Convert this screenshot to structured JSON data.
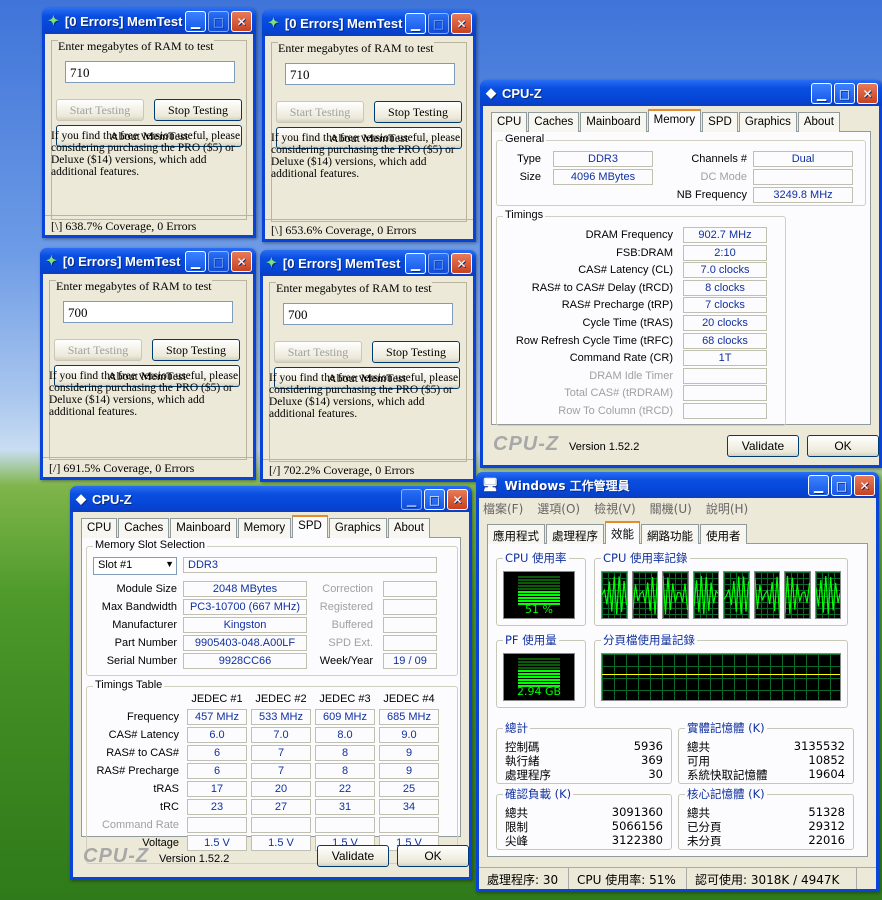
{
  "memtest": [
    {
      "title": "[0 Errors] MemTest",
      "prompt": "Enter megabytes of RAM to test",
      "value": "710",
      "start": "Start Testing",
      "stop": "Stop Testing",
      "about": "About MemTest",
      "info": "If you find the free version useful, please considering purchasing the PRO ($5) or Deluxe ($14) versions, which add additional features.",
      "status": "[\\]   638.7% Coverage, 0 Errors"
    },
    {
      "title": "[0 Errors] MemTest",
      "prompt": "Enter megabytes of RAM to test",
      "value": "710",
      "start": "Start Testing",
      "stop": "Stop Testing",
      "about": "About MemTest",
      "info": "If you find the free version useful, please considering purchasing the PRO ($5) or Deluxe ($14) versions, which add additional features.",
      "status": "[\\]   653.6% Coverage, 0 Errors"
    },
    {
      "title": "[0 Errors] MemTest",
      "prompt": "Enter megabytes of RAM to test",
      "value": "700",
      "start": "Start Testing",
      "stop": "Stop Testing",
      "about": "About MemTest",
      "info": "If you find the free version useful, please considering purchasing the PRO ($5) or Deluxe ($14) versions, which add additional features.",
      "status": "[/]   691.5% Coverage, 0 Errors"
    },
    {
      "title": "[0 Errors] MemTest",
      "prompt": "Enter megabytes of RAM to test",
      "value": "700",
      "start": "Start Testing",
      "stop": "Stop Testing",
      "about": "About MemTest",
      "info": "If you find the free version useful, please considering purchasing the PRO ($5) or Deluxe ($14) versions, which add additional features.",
      "status": "[/]   702.2% Coverage, 0 Errors"
    }
  ],
  "cpuz_mem": {
    "title": "CPU-Z",
    "tabs": [
      "CPU",
      "Caches",
      "Mainboard",
      "Memory",
      "SPD",
      "Graphics",
      "About"
    ],
    "active_tab": "Memory",
    "general_label": "General",
    "type_label": "Type",
    "type": "DDR3",
    "size_label": "Size",
    "size": "4096 MBytes",
    "channels_label": "Channels #",
    "channels": "Dual",
    "dcmode_label": "DC Mode",
    "dcmode": "",
    "nbfreq_label": "NB Frequency",
    "nbfreq": "3249.8 MHz",
    "timings_label": "Timings",
    "timings": [
      {
        "label": "DRAM Frequency",
        "value": "902.7 MHz",
        "dim": false
      },
      {
        "label": "FSB:DRAM",
        "value": "2:10",
        "dim": false
      },
      {
        "label": "CAS# Latency (CL)",
        "value": "7.0 clocks",
        "dim": false
      },
      {
        "label": "RAS# to CAS# Delay (tRCD)",
        "value": "8 clocks",
        "dim": false
      },
      {
        "label": "RAS# Precharge (tRP)",
        "value": "7 clocks",
        "dim": false
      },
      {
        "label": "Cycle Time (tRAS)",
        "value": "20 clocks",
        "dim": false
      },
      {
        "label": "Row Refresh Cycle Time (tRFC)",
        "value": "68 clocks",
        "dim": false
      },
      {
        "label": "Command Rate (CR)",
        "value": "1T",
        "dim": false
      },
      {
        "label": "DRAM Idle Timer",
        "value": "",
        "dim": true
      },
      {
        "label": "Total CAS# (tRDRAM)",
        "value": "",
        "dim": true
      },
      {
        "label": "Row To Column (tRCD)",
        "value": "",
        "dim": true
      }
    ],
    "logo": "CPU-Z",
    "version": "Version 1.52.2",
    "validate": "Validate",
    "ok": "OK"
  },
  "cpuz_spd": {
    "title": "CPU-Z",
    "tabs": [
      "CPU",
      "Caches",
      "Mainboard",
      "Memory",
      "SPD",
      "Graphics",
      "About"
    ],
    "active_tab": "SPD",
    "slot_group": "Memory Slot Selection",
    "slot": "Slot #1",
    "slot_type": "DDR3",
    "left": [
      {
        "label": "Module Size",
        "value": "2048 MBytes"
      },
      {
        "label": "Max Bandwidth",
        "value": "PC3-10700 (667 MHz)"
      },
      {
        "label": "Manufacturer",
        "value": "Kingston"
      },
      {
        "label": "Part Number",
        "value": "9905403-048.A00LF"
      },
      {
        "label": "Serial Number",
        "value": "9928CC66"
      }
    ],
    "right": [
      {
        "label": "Correction",
        "value": "",
        "dim": true
      },
      {
        "label": "Registered",
        "value": "",
        "dim": true
      },
      {
        "label": "Buffered",
        "value": "",
        "dim": true
      },
      {
        "label": "SPD Ext.",
        "value": "",
        "dim": true
      },
      {
        "label": "Week/Year",
        "value": "19 / 09",
        "dim": false
      }
    ],
    "timings_group": "Timings Table",
    "cols": [
      "JEDEC #1",
      "JEDEC #2",
      "JEDEC #3",
      "JEDEC #4"
    ],
    "rows": [
      {
        "label": "Frequency",
        "vals": [
          "457 MHz",
          "533 MHz",
          "609 MHz",
          "685 MHz"
        ],
        "dim": false
      },
      {
        "label": "CAS# Latency",
        "vals": [
          "6.0",
          "7.0",
          "8.0",
          "9.0"
        ],
        "dim": false
      },
      {
        "label": "RAS# to CAS#",
        "vals": [
          "6",
          "7",
          "8",
          "9"
        ],
        "dim": false
      },
      {
        "label": "RAS# Precharge",
        "vals": [
          "6",
          "7",
          "8",
          "9"
        ],
        "dim": false
      },
      {
        "label": "tRAS",
        "vals": [
          "17",
          "20",
          "22",
          "25"
        ],
        "dim": false
      },
      {
        "label": "tRC",
        "vals": [
          "23",
          "27",
          "31",
          "34"
        ],
        "dim": false
      },
      {
        "label": "Command Rate",
        "vals": [
          "",
          "",
          "",
          ""
        ],
        "dim": true
      },
      {
        "label": "Voltage",
        "vals": [
          "1.5 V",
          "1.5 V",
          "1.5 V",
          "1.5 V"
        ],
        "dim": false
      }
    ],
    "logo": "CPU-Z",
    "version": "Version 1.52.2",
    "validate": "Validate",
    "ok": "OK"
  },
  "taskmgr": {
    "title": "Windows 工作管理員",
    "menu": [
      "檔案(F)",
      "選項(O)",
      "檢視(V)",
      "關機(U)",
      "說明(H)"
    ],
    "tabs": [
      "應用程式",
      "處理程序",
      "效能",
      "網路功能",
      "使用者"
    ],
    "active_tab": "效能",
    "cpu_usage_label": "CPU 使用率",
    "cpu_usage": "51 %",
    "cpu_usage_pct": 51,
    "cpu_history_label": "CPU 使用率記錄",
    "pf_label": "PF 使用量",
    "pf": "2.94 GB",
    "pf_fraction": 0.6,
    "pf_history_label": "分頁檔使用量記錄",
    "totals_label": "總計",
    "totals": [
      {
        "k": "控制碼",
        "v": "5936"
      },
      {
        "k": "執行緒",
        "v": "369"
      },
      {
        "k": "處理程序",
        "v": "30"
      }
    ],
    "physical_label": "實體記憶體 (K)",
    "physical": [
      {
        "k": "總共",
        "v": "3135532"
      },
      {
        "k": "可用",
        "v": "10852"
      },
      {
        "k": "系統快取記憶體",
        "v": "19604"
      }
    ],
    "commit_label": "確認負載 (K)",
    "commit": [
      {
        "k": "總共",
        "v": "3091360"
      },
      {
        "k": "限制",
        "v": "5066156"
      },
      {
        "k": "尖峰",
        "v": "3122380"
      }
    ],
    "kernel_label": "核心記憶體 (K)",
    "kernel": [
      {
        "k": "總共",
        "v": "51328"
      },
      {
        "k": "已分頁",
        "v": "29312"
      },
      {
        "k": "未分頁",
        "v": "22016"
      }
    ],
    "status": [
      "處理程序: 30",
      "CPU 使用率: 51%",
      "認可使用: 3018K / 4947K"
    ]
  }
}
